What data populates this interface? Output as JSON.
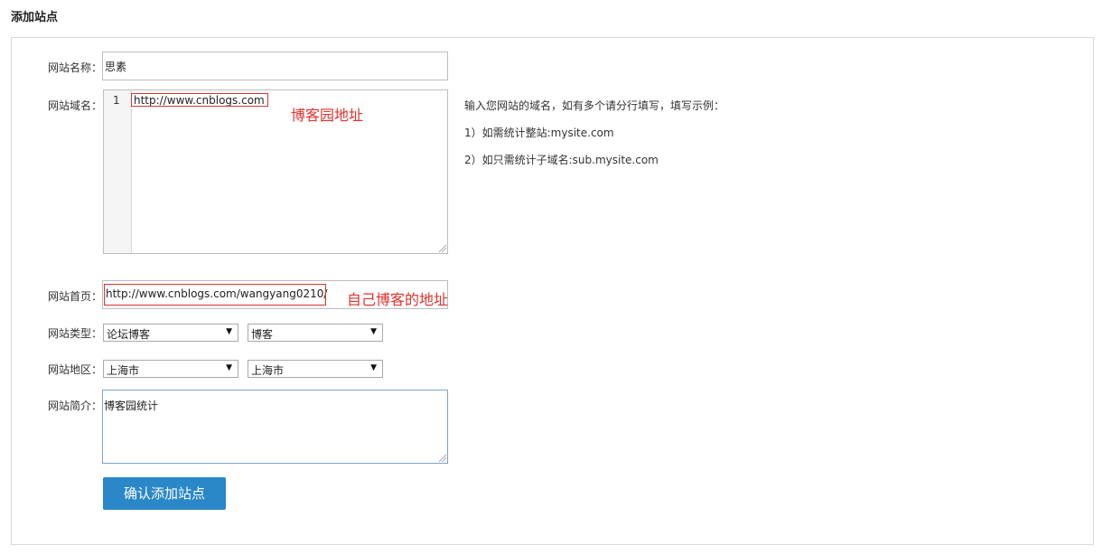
{
  "page": {
    "title": "添加站点"
  },
  "form": {
    "name": {
      "label": "网站名称：",
      "value": "思素"
    },
    "domain": {
      "label": "网站域名：",
      "line_number": "1",
      "value": "http://www.cnblogs.com",
      "annotation": "博客园地址"
    },
    "help": {
      "intro": "输入您网站的域名，如有多个请分行填写，填写示例：",
      "example1": "1）如需统计整站:mysite.com",
      "example2": "2）如只需统计子域名:sub.mysite.com"
    },
    "homepage": {
      "label": "网站首页：",
      "value": "http://www.cnblogs.com/wangyang0210/",
      "annotation": "自己博客的地址"
    },
    "type": {
      "label": "网站类型：",
      "primary": "论坛博客",
      "secondary": "博客"
    },
    "region": {
      "label": "网站地区：",
      "province": "上海市",
      "city": "上海市"
    },
    "intro": {
      "label": "网站简介：",
      "value": "博客园统计"
    },
    "submit_label": "确认添加站点"
  },
  "icons": {
    "select_caret": "caret-down-icon",
    "resize": "resize-grip-icon"
  },
  "colors": {
    "annotation": "#e0322e",
    "button": "#2a87c8",
    "focus_border": "#7da2ce"
  }
}
